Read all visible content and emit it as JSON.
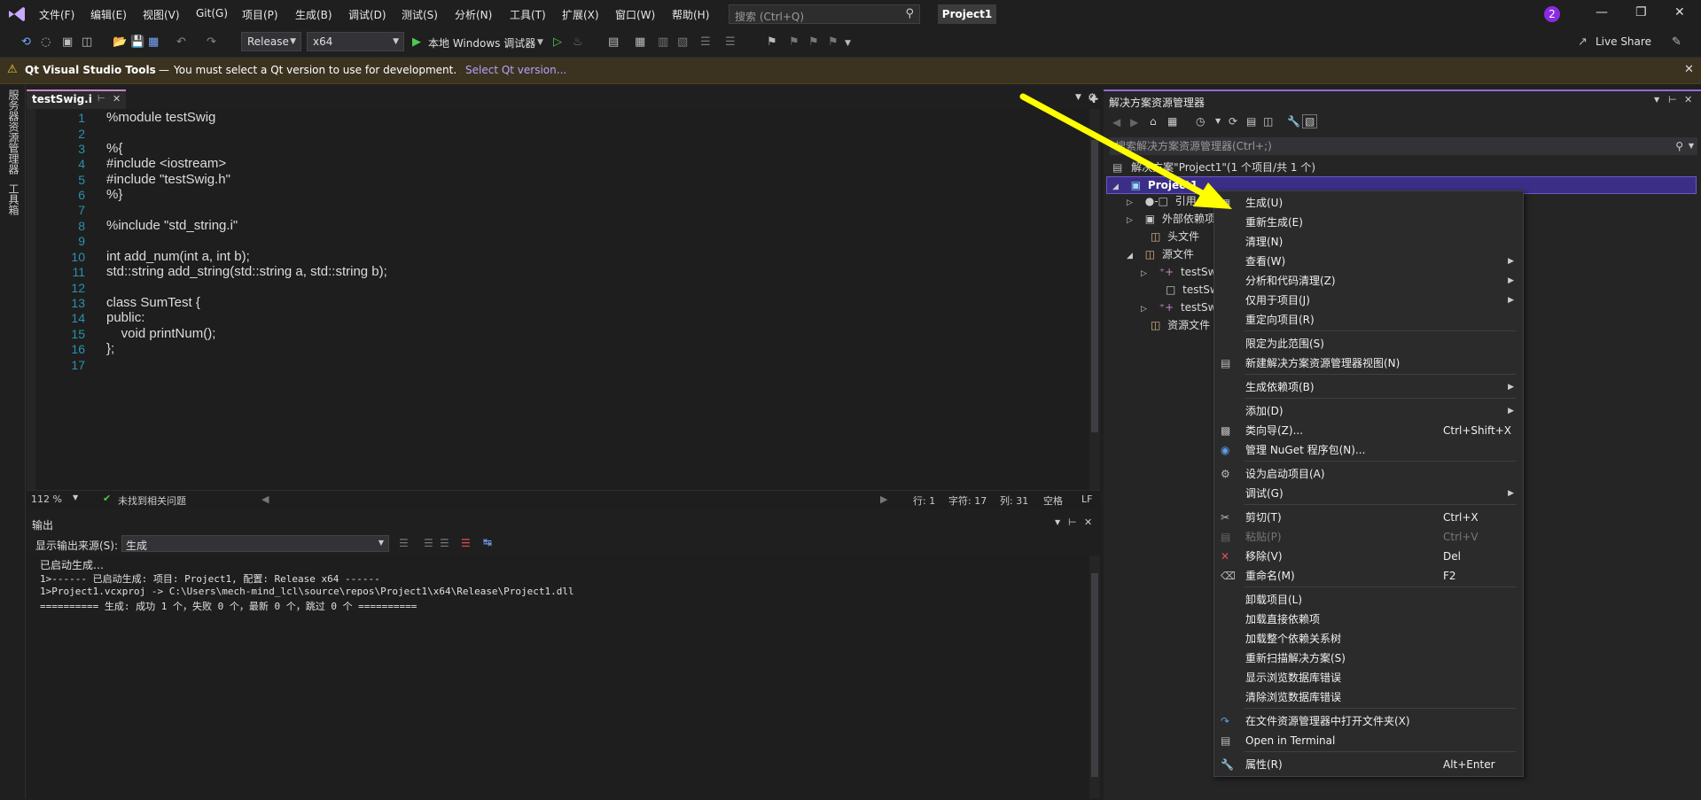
{
  "menu": [
    "文件(F)",
    "编辑(E)",
    "视图(V)",
    "Git(G)",
    "项目(P)",
    "生成(B)",
    "调试(D)",
    "测试(S)",
    "分析(N)",
    "工具(T)",
    "扩展(X)",
    "窗口(W)",
    "帮助(H)"
  ],
  "search": {
    "placeholder": "搜索 (Ctrl+Q)"
  },
  "project_title": "Project1",
  "notification_count": "2",
  "toolbar": {
    "config": "Release",
    "platform": "x64",
    "debugger": "本地 Windows 调试器",
    "live_share": "Live Share"
  },
  "infobar": {
    "source": "Qt Visual Studio Tools",
    "dash": "—",
    "message": "You must select a Qt version to use for development.",
    "link": "Select Qt version..."
  },
  "left_tabs": [
    "服务器资源管理器",
    "工具箱"
  ],
  "editor": {
    "tab": "testSwig.i",
    "lines": [
      {
        "n": "1",
        "t": "%module testSwig"
      },
      {
        "n": "2",
        "t": ""
      },
      {
        "n": "3",
        "t": "%{"
      },
      {
        "n": "4",
        "t": "#include <iostream>"
      },
      {
        "n": "5",
        "t": "#include \"testSwig.h\""
      },
      {
        "n": "6",
        "t": "%}"
      },
      {
        "n": "7",
        "t": ""
      },
      {
        "n": "8",
        "t": "%include \"std_string.i\""
      },
      {
        "n": "9",
        "t": ""
      },
      {
        "n": "10",
        "t": "int add_num(int a, int b);"
      },
      {
        "n": "11",
        "t": "std::string add_string(std::string a, std::string b);"
      },
      {
        "n": "12",
        "t": ""
      },
      {
        "n": "13",
        "t": "class SumTest {"
      },
      {
        "n": "14",
        "t": "public:"
      },
      {
        "n": "15",
        "t": "    void printNum();"
      },
      {
        "n": "16",
        "t": "};"
      },
      {
        "n": "17",
        "t": ""
      }
    ],
    "status": {
      "zoom": "112 %",
      "issues": "未找到相关问题",
      "line": "行: 1",
      "char": "字符: 17",
      "col": "列: 31",
      "space": "空格",
      "eol": "LF"
    }
  },
  "output": {
    "title": "输出",
    "source_label": "显示输出来源(S):",
    "source_value": "生成",
    "lines": [
      "已启动生成…",
      "1>------ 已启动生成: 项目: Project1, 配置: Release x64 ------",
      "1>Project1.vcxproj -> C:\\Users\\mech-mind_lcl\\source\\repos\\Project1\\x64\\Release\\Project1.dll",
      "========== 生成: 成功 1 个，失败 0 个，最新 0 个，跳过 0 个 =========="
    ]
  },
  "solution": {
    "title": "解决方案资源管理器",
    "search_placeholder": "搜索解决方案资源管理器(Ctrl+;)",
    "tree": [
      {
        "label": "解决方案\"Project1\"(1 个项目/共 1 个)"
      },
      {
        "label": "Project1"
      },
      {
        "label": "引用"
      },
      {
        "label": "外部依赖项"
      },
      {
        "label": "头文件"
      },
      {
        "label": "源文件"
      },
      {
        "label": "testSw"
      },
      {
        "label": "testSw"
      },
      {
        "label": "testSw"
      },
      {
        "label": "资源文件"
      }
    ]
  },
  "context_menu": [
    {
      "label": "生成(U)",
      "icon": "build-icon"
    },
    {
      "label": "重新生成(E)"
    },
    {
      "label": "清理(N)"
    },
    {
      "label": "查看(W)",
      "submenu": true
    },
    {
      "label": "分析和代码清理(Z)",
      "submenu": true
    },
    {
      "label": "仅用于项目(J)",
      "submenu": true
    },
    {
      "label": "重定向项目(R)"
    },
    {
      "label": "限定为此范围(S)"
    },
    {
      "label": "新建解决方案资源管理器视图(N)",
      "icon": "new-view-icon"
    },
    {
      "label": "生成依赖项(B)",
      "submenu": true
    },
    {
      "label": "添加(D)",
      "submenu": true
    },
    {
      "label": "类向导(Z)...",
      "shortcut": "Ctrl+Shift+X",
      "icon": "class-wizard-icon"
    },
    {
      "label": "管理 NuGet 程序包(N)...",
      "icon": "nuget-icon"
    },
    {
      "label": "设为启动项目(A)",
      "icon": "gear-icon"
    },
    {
      "label": "调试(G)",
      "submenu": true
    },
    {
      "label": "剪切(T)",
      "shortcut": "Ctrl+X",
      "icon": "scissors-icon"
    },
    {
      "label": "粘贴(P)",
      "shortcut": "Ctrl+V",
      "icon": "paste-icon",
      "disabled": true
    },
    {
      "label": "移除(V)",
      "shortcut": "Del",
      "icon": "remove-icon"
    },
    {
      "label": "重命名(M)",
      "shortcut": "F2",
      "icon": "rename-icon"
    },
    {
      "label": "卸载项目(L)"
    },
    {
      "label": "加载直接依赖项"
    },
    {
      "label": "加载整个依赖关系树"
    },
    {
      "label": "重新扫描解决方案(S)"
    },
    {
      "label": "显示浏览数据库错误"
    },
    {
      "label": "清除浏览数据库错误"
    },
    {
      "label": "在文件资源管理器中打开文件夹(X)",
      "icon": "open-folder-icon"
    },
    {
      "label": "Open in Terminal",
      "icon": "terminal-icon"
    },
    {
      "label": "属性(R)",
      "shortcut": "Alt+Enter",
      "icon": "wrench-icon"
    }
  ],
  "colors": {
    "accent": "#8f6cd9",
    "selection": "#3b2e86",
    "arrow": "#ffff00",
    "infobar": "#3b3320"
  }
}
